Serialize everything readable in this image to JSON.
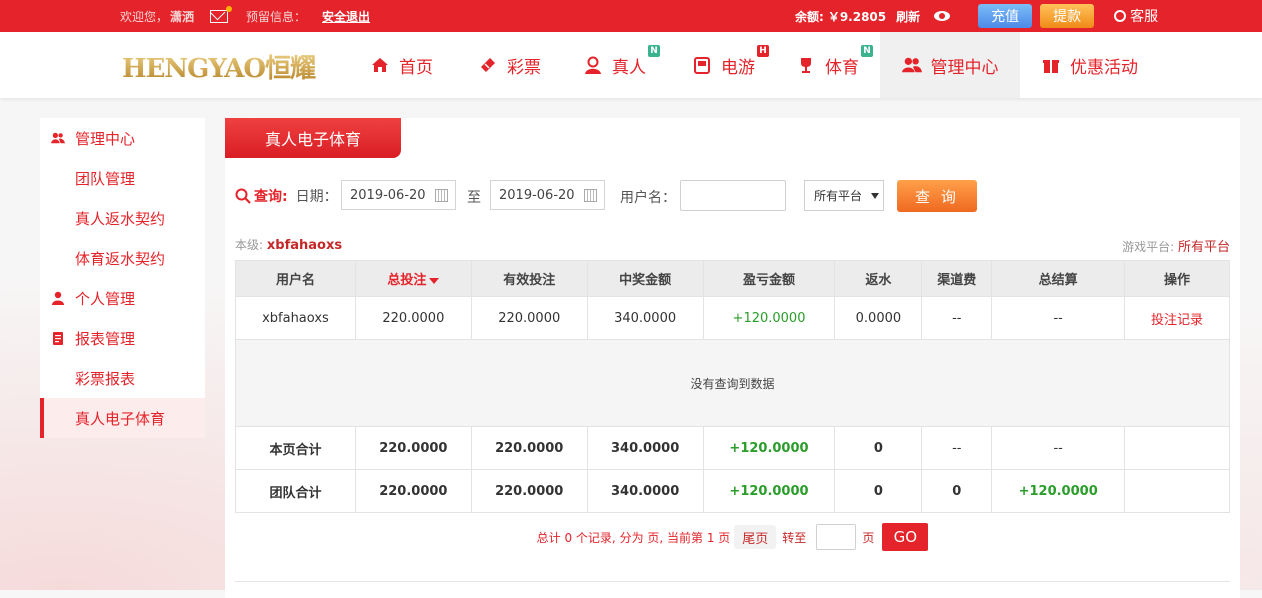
{
  "topbar": {
    "welcome": "欢迎您，",
    "username": "潇洒",
    "notice_label": "预留信息：",
    "logout": "安全退出",
    "balance_label": "余额:",
    "balance_value": "￥9.2805",
    "refresh": "刷新",
    "charge": "充值",
    "withdraw": "提款",
    "service": "客服"
  },
  "logo": {
    "text": "HENGYAO恒耀"
  },
  "nav": {
    "items": [
      {
        "label": "首页",
        "icon": "home-icon"
      },
      {
        "label": "彩票",
        "icon": "ticket-icon"
      },
      {
        "label": "真人",
        "icon": "person-icon",
        "badge": "N"
      },
      {
        "label": "电游",
        "icon": "arcade-icon",
        "badge": "H"
      },
      {
        "label": "体育",
        "icon": "trophy-icon",
        "badge": "N"
      },
      {
        "label": "管理中心",
        "icon": "users-icon",
        "active": true
      },
      {
        "label": "优惠活动",
        "icon": "gift-icon"
      }
    ]
  },
  "sidebar": {
    "items": [
      {
        "label": "管理中心",
        "icon": "users-icon"
      },
      {
        "label": "团队管理"
      },
      {
        "label": "真人返水契约"
      },
      {
        "label": "体育返水契约"
      },
      {
        "label": "个人管理",
        "icon": "user-icon"
      },
      {
        "label": "报表管理",
        "icon": "report-icon"
      },
      {
        "label": "彩票报表"
      },
      {
        "label": "真人电子体育",
        "active": true
      }
    ]
  },
  "panel": {
    "tab_title": "真人电子体育",
    "query_title": "查询:",
    "date_label": "日期：",
    "date_from": "2019-06-20",
    "to_label": "至",
    "date_to": "2019-06-20",
    "username_label": "用户名：",
    "username_value": "",
    "platform_select": "所有平台",
    "query_button": "查 询",
    "level_label": "本级:",
    "level_user": "xbfahaoxs",
    "platform_label": "游戏平台:",
    "platform_value": "所有平台"
  },
  "table": {
    "headers": [
      "用户名",
      "总投注",
      "有效投注",
      "中奖金额",
      "盈亏金额",
      "返水",
      "渠道费",
      "总结算",
      "操作"
    ],
    "row": [
      "xbfahaoxs",
      "220.0000",
      "220.0000",
      "340.0000",
      "+120.0000",
      "0.0000",
      "--",
      "--",
      "投注记录"
    ],
    "empty_text": "没有查询到数据",
    "page_total": [
      "本页合计",
      "220.0000",
      "220.0000",
      "340.0000",
      "+120.0000",
      "0",
      "--",
      "--",
      ""
    ],
    "team_total": [
      "团队合计",
      "220.0000",
      "220.0000",
      "340.0000",
      "+120.0000",
      "0",
      "0",
      "+120.0000",
      ""
    ]
  },
  "pager": {
    "summary": "总计 0 个记录, 分为 页, 当前第 1 页",
    "last": "尾页",
    "goto": "转至",
    "page": "页",
    "go": "GO"
  },
  "colors": {
    "brand_red": "#e4242a",
    "profit_green": "#2a9d2a",
    "query_orange": "#ef6920"
  }
}
